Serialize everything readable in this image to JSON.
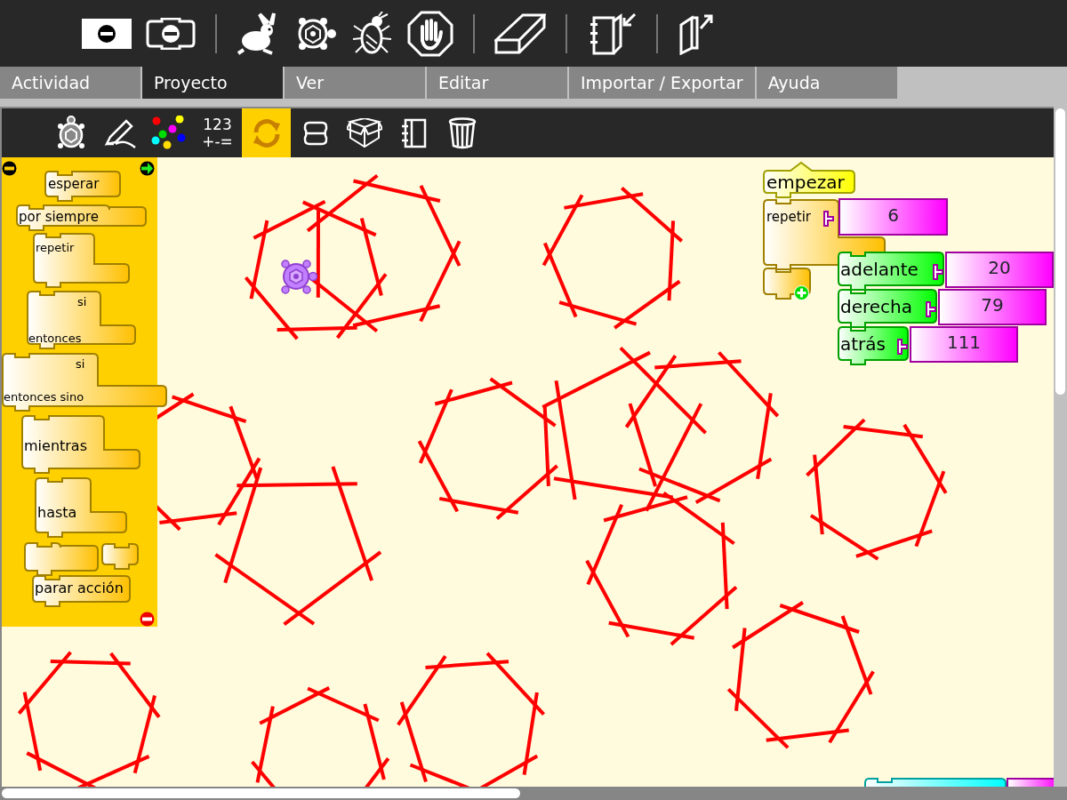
{
  "menu_tabs": [
    {
      "label": "Actividad",
      "selected": false
    },
    {
      "label": "Proyecto",
      "selected": true
    },
    {
      "label": "Ver",
      "selected": false
    },
    {
      "label": "Editar",
      "selected": false
    },
    {
      "label": "Importar / Exportar",
      "selected": false
    },
    {
      "label": "Ayuda",
      "selected": false
    }
  ],
  "palette_buttons": [
    {
      "kind": "turtle",
      "selected": false
    },
    {
      "kind": "pen",
      "selected": false
    },
    {
      "kind": "colors",
      "selected": false
    },
    {
      "kind": "numbers",
      "lines": [
        "123",
        "+-="
      ],
      "selected": false
    },
    {
      "kind": "flow",
      "selected": true
    },
    {
      "kind": "blocks",
      "selected": false
    },
    {
      "kind": "extras",
      "selected": false
    },
    {
      "kind": "media",
      "selected": false
    },
    {
      "kind": "trash",
      "selected": false
    }
  ],
  "palette_blocks": [
    {
      "kind": "wait",
      "labels": [
        "esperar"
      ]
    },
    {
      "kind": "forever",
      "labels": [
        "por siempre"
      ]
    },
    {
      "kind": "repeat",
      "labels": [
        "repetir"
      ]
    },
    {
      "kind": "if",
      "labels": [
        "si",
        "entonces"
      ]
    },
    {
      "kind": "ifelse",
      "labels": [
        "si",
        "entonces sino"
      ]
    },
    {
      "kind": "while",
      "labels": [
        "mientras"
      ]
    },
    {
      "kind": "until",
      "labels": [
        "hasta"
      ]
    },
    {
      "kind": "open_clamp"
    },
    {
      "kind": "stack"
    },
    {
      "kind": "stop",
      "labels": [
        "parar acción"
      ]
    }
  ],
  "program": [
    {
      "kind": "start",
      "label": "empezar"
    },
    {
      "kind": "repeat",
      "label": "repetir",
      "value": "6"
    },
    {
      "kind": "action",
      "label": "adelante",
      "value": "20"
    },
    {
      "kind": "action",
      "label": "derecha",
      "value": "79"
    },
    {
      "kind": "action",
      "label": "atrás",
      "value": "111"
    },
    {
      "kind": "collapse"
    },
    {
      "kind": "cut_off"
    }
  ]
}
